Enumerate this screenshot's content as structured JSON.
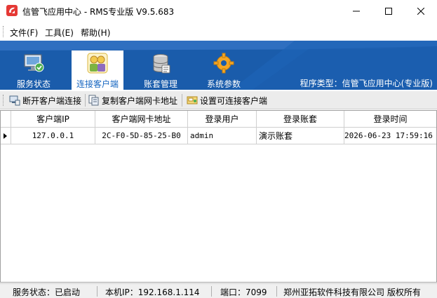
{
  "window": {
    "title": "信管飞应用中心 - RMS专业版 V9.5.683"
  },
  "menu": {
    "items": [
      "文件(F)",
      "工具(E)",
      "帮助(H)"
    ]
  },
  "tabs": [
    {
      "label": "服务状态",
      "icon": "monitor-check-icon",
      "active": false
    },
    {
      "label": "连接客户端",
      "icon": "users-icon",
      "active": true
    },
    {
      "label": "账套管理",
      "icon": "database-icon",
      "active": false
    },
    {
      "label": "系统参数",
      "icon": "gear-icon",
      "active": false
    }
  ],
  "program_type": "程序类型：信管飞应用中心(专业版)",
  "toolbar": {
    "disconnect_label": "断开客户端连接",
    "copy_mac_label": "复制客户端网卡地址",
    "set_allowed_label": "设置可连接客户端"
  },
  "grid": {
    "columns": [
      "客户端IP",
      "客户端网卡地址",
      "登录用户",
      "登录账套",
      "登录时间"
    ],
    "rows": [
      {
        "ip": "127.0.0.1",
        "mac": "2C-F0-5D-85-25-B0",
        "user": "admin",
        "account": "演示账套",
        "time": "2026-06-23 17:59:16"
      }
    ]
  },
  "status": {
    "service_state": "服务状态：已启动",
    "local_ip": "本机IP：192.168.1.114",
    "port": "端口：7099",
    "copyright": "郑州亚拓软件科技有限公司 版权所有"
  },
  "colors": {
    "banner_blue": "#1a5cab",
    "active_tab_text": "#1565c0",
    "app_icon_red": "#e53935"
  }
}
